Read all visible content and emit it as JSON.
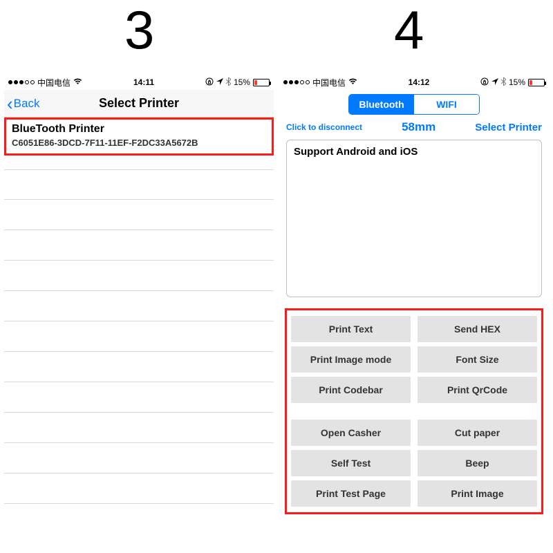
{
  "labels": {
    "left": "3",
    "right": "4"
  },
  "status": {
    "carrier": "中国电信",
    "time_left": "14:11",
    "time_right": "14:12",
    "battery_pct": "15%",
    "lock": "⊕",
    "location": "➤",
    "bluetooth": "✱"
  },
  "left_phone": {
    "nav_back": "Back",
    "nav_title": "Select Printer",
    "printer_name": "BlueTooth Printer",
    "printer_uuid": "C6051E86-3DCD-7F11-11EF-F2DC33A5672B"
  },
  "right_phone": {
    "segment": {
      "bluetooth": "Bluetooth",
      "wifi": "WIFI"
    },
    "conn_left": "Click to disconnect",
    "conn_mid": "58mm",
    "conn_right": "Select Printer",
    "panel_text": "Support Android and iOS",
    "buttons": {
      "b0": "Print Text",
      "b1": "Send HEX",
      "b2": "Print Image mode",
      "b3": "Font Size",
      "b4": "Print Codebar",
      "b5": "Print QrCode",
      "b6": "Open Casher",
      "b7": "Cut paper",
      "b8": "Self Test",
      "b9": "Beep",
      "b10": "Print Test Page",
      "b11": "Print Image"
    }
  }
}
